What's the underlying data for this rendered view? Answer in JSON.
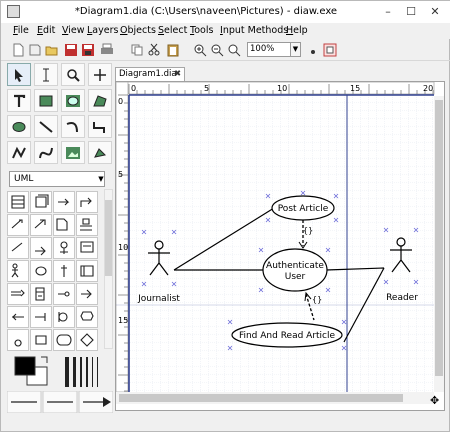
{
  "window": {
    "title": "*Diagram1.dia (C:\\Users\\naveen\\Pictures) - diaw.exe",
    "minimize": "–",
    "maximize": "☐",
    "close": "✕"
  },
  "menu": [
    "File",
    "Edit",
    "View",
    "Layers",
    "Objects",
    "Select",
    "Tools",
    "Input Methods",
    "Help"
  ],
  "toolbar": {
    "zoom": "100%"
  },
  "toolbox": {
    "sheet": "UML"
  },
  "tab": {
    "label": "Diagram1.dia",
    "close": "✖"
  },
  "ruler": {
    "top_ticks": [
      "0",
      "5",
      "10",
      "15",
      "20"
    ],
    "left_ticks": [
      "0",
      "5",
      "10",
      "15"
    ]
  },
  "diagram": {
    "actors": [
      "Journalist",
      "Reader"
    ],
    "usecases": [
      "Post Article",
      "Authenticate User",
      "Find And Read Article"
    ],
    "authenticate_lines": [
      "Authenticate",
      "User"
    ],
    "dependency_label": "{}"
  }
}
